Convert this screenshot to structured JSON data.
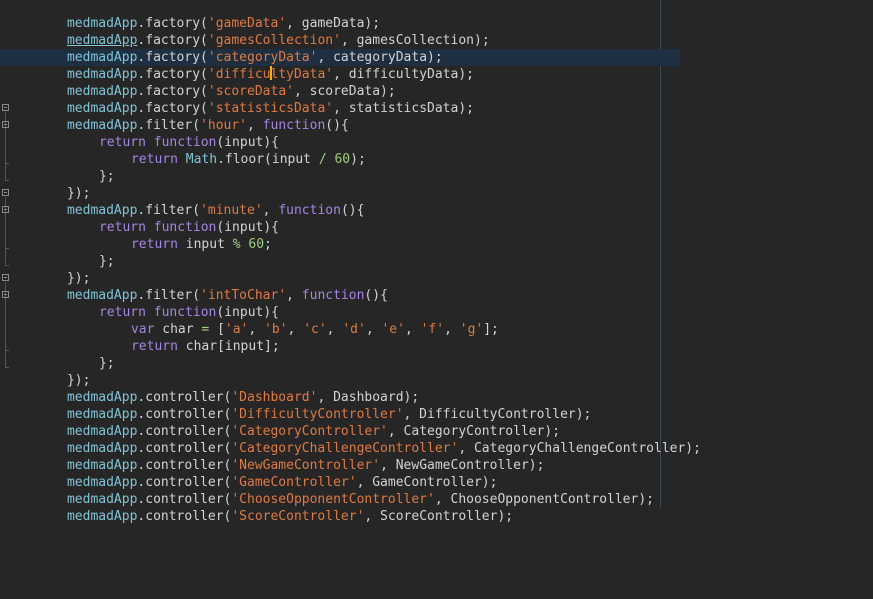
{
  "editor": {
    "icons": {
      "fold_marker": "fold-toggle-icon"
    },
    "colors": {
      "background": "#262626",
      "current_line": "#1e2f42",
      "identifier": "#7ec4d6",
      "string": "#e07a3f",
      "keyword": "#a585e0",
      "number": "#9fd07a",
      "text": "#d2d2d2",
      "caret": "#ffb200"
    },
    "lines": [
      {
        "a": "medmadApp",
        "b": ".factory(",
        "s": "'gameData'",
        "c": ", gameData);"
      },
      {
        "a": "medmadApp",
        "b": ".factory(",
        "s": "'gamesCollection'",
        "c": ", gamesCollection);"
      },
      {
        "a": "medmadApp",
        "b": ".factory(",
        "s": "'categoryData'",
        "c": ", categoryData);"
      },
      {
        "a": "medmadApp",
        "b": ".factory(",
        "s1": "'difficu",
        "s2": "ltyData'",
        "c": ", difficultyData);"
      },
      {
        "a": "medmadApp",
        "b": ".factory(",
        "s": "'scoreData'",
        "c": ", scoreData);"
      },
      {
        "a": "medmadApp",
        "b": ".factory(",
        "s": "'statisticsData'",
        "c": ", statisticsData);"
      },
      {
        "a": "medmadApp",
        "b": ".filter(",
        "s": "'hour'",
        "c": ", ",
        "k": "function",
        "d": "(){"
      },
      {
        "k": "return",
        "sp": " ",
        "k2": "function",
        "d": "(input){"
      },
      {
        "k": "return",
        "sp": " ",
        "o": "Math",
        "d": ".floor(input ",
        "op": "/",
        "sp2": " ",
        "n": "60",
        "e": ");"
      },
      {
        "d": "};"
      },
      {
        "d": "});"
      },
      {
        "a": "medmadApp",
        "b": ".filter(",
        "s": "'minute'",
        "c": ", ",
        "k": "function",
        "d": "(){"
      },
      {
        "k": "return",
        "sp": " ",
        "k2": "function",
        "d": "(input){"
      },
      {
        "k": "return",
        "d": " input ",
        "op": "%",
        "sp2": " ",
        "n": "60",
        "e": ";"
      },
      {
        "d": "};"
      },
      {
        "d": "});"
      },
      {
        "a": "medmadApp",
        "b": ".filter(",
        "s": "'intToChar'",
        "c": ", ",
        "k": "function",
        "d": "(){"
      },
      {
        "k": "return",
        "sp": " ",
        "k2": "function",
        "d": "(input){"
      },
      {
        "k": "var",
        "d": " char ",
        "op": "=",
        "d2": " [",
        "s_a": "'a'",
        "s_b": "'b'",
        "s_c": "'c'",
        "s_d": "'d'",
        "s_e": "'e'",
        "s_f": "'f'",
        "s_g": "'g'",
        "sep": ", ",
        "e": "];"
      },
      {
        "k": "return",
        "d": " char[input];"
      },
      {
        "d": "};"
      },
      {
        "d": "});"
      },
      {
        "a": "medmadApp",
        "b": ".controller(",
        "s": "'Dashboard'",
        "c": ", Dashboard);"
      },
      {
        "a": "medmadApp",
        "b": ".controller(",
        "s": "'DifficultyController'",
        "c": ", DifficultyController);"
      },
      {
        "a": "medmadApp",
        "b": ".controller(",
        "s": "'CategoryController'",
        "c": ", CategoryController);"
      },
      {
        "a": "medmadApp",
        "b": ".controller(",
        "s": "'CategoryChallengeController'",
        "c": ", CategoryChallengeController);"
      },
      {
        "a": "medmadApp",
        "b": ".controller(",
        "s": "'NewGameController'",
        "c": ", NewGameController);"
      },
      {
        "a": "medmadApp",
        "b": ".controller(",
        "s": "'GameController'",
        "c": ", GameController);"
      },
      {
        "a": "medmadApp",
        "b": ".controller(",
        "s": "'ChooseOpponentController'",
        "c": ", ChooseOpponentController);"
      },
      {
        "a": "medmadApp",
        "b": ".controller(",
        "s": "'ScoreController'",
        "c": ", ScoreController);"
      }
    ]
  }
}
